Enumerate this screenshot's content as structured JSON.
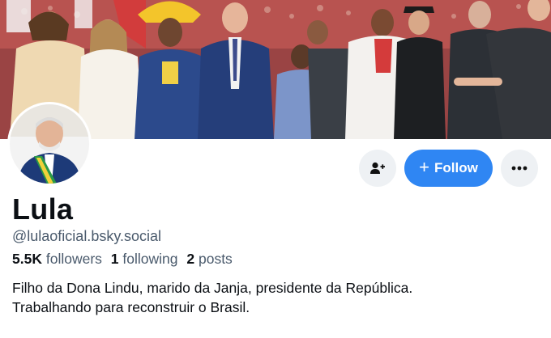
{
  "profile": {
    "display_name": "Lula",
    "handle": "@lulaoficial.bsky.social",
    "stats": {
      "followers_count": "5.5K",
      "followers_label": "followers",
      "following_count": "1",
      "following_label": "following",
      "posts_count": "2",
      "posts_label": "posts"
    },
    "bio": [
      "Filho da Dona Lindu, marido da Janja, presidente da República.",
      "Trabalhando para reconstruir o Brasil."
    ]
  },
  "actions": {
    "add_user_icon": "person-plus-icon",
    "follow_label": "Follow",
    "follow_icon": "+",
    "more_icon": "ellipsis-icon"
  },
  "colors": {
    "accent": "#2f86f3",
    "secondary_button": "#eef1f4",
    "muted_text": "#4a5a6c",
    "primary_text": "#0b0f14"
  }
}
